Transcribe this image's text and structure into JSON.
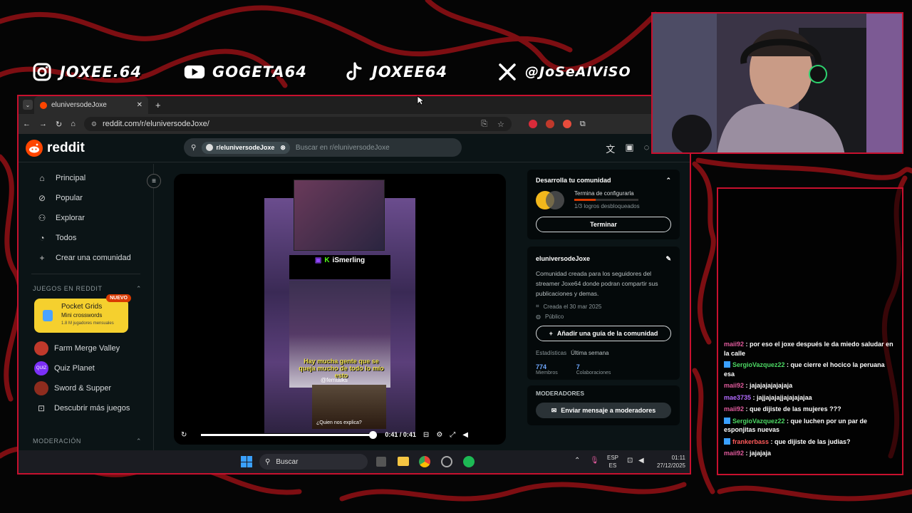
{
  "socials": [
    {
      "icon": "instagram-icon",
      "handle": "JOXEE.64"
    },
    {
      "icon": "youtube-icon",
      "handle": "GOGETA64"
    },
    {
      "icon": "tiktok-icon",
      "handle": "JOXEE64"
    },
    {
      "icon": "x-icon",
      "handle": "@JoSeAlViSO"
    }
  ],
  "browser": {
    "tab_title": "eluniversodeJoxe",
    "url": "reddit.com/r/eluniversodeJoxe/"
  },
  "reddit": {
    "logo": "reddit",
    "search_chip": "r/eluniversodeJoxe",
    "search_placeholder": "Buscar en r/eluniversodeJoxe",
    "nav": [
      "Principal",
      "Popular",
      "Explorar",
      "Todos",
      "Crear una comunidad"
    ],
    "games_section": "JUEGOS EN REDDIT",
    "featured_game": {
      "title": "Pocket Grids",
      "subtitle": "Mini crosswords",
      "players": "1.8 M jugadores mensuales",
      "badge": "NUEVO"
    },
    "games": [
      "Farm Merge Valley",
      "Quiz Planet",
      "Sword & Supper",
      "Descubrir más juegos"
    ],
    "moderation_section": "MODERACIÓN",
    "video": {
      "overlay_name": "iSmerling",
      "caption": "Hay mucha gente que se queja mucho de todo lo mío esto",
      "handle": "@femtalks",
      "meme_caption": "¿Quien nos explica?",
      "time": "0:41 / 0:41",
      "progress": 1.0
    },
    "right": {
      "develop_title": "Desarrolla tu comunidad",
      "develop_task": "Termina de configurarla",
      "develop_progress": "1/3 logros desbloqueados",
      "finish_button": "Terminar",
      "community_name": "eluniversodeJoxe",
      "description": "Comunidad creada para los seguidores del streamer Joxe64 donde podran compartir sus publicaciones y demas.",
      "created": "Creada el 30 mar 2025",
      "visibility": "Público",
      "guide_button": "Añadir una guía de la comunidad",
      "stats_label": "Estadísticas",
      "stats_period": "Última semana",
      "members_value": "774",
      "members_label": "Miembros",
      "contrib_value": "7",
      "contrib_label": "Colaboraciones",
      "moderators_title": "MODERADORES",
      "message_mods_button": "Enviar mensaje a moderadores"
    }
  },
  "taskbar": {
    "search": "Buscar",
    "lang_top": "ESP",
    "lang_bottom": "ES",
    "time": "01:11",
    "date": "27/12/2025"
  },
  "chat": [
    {
      "user": "maii92",
      "color": "#e05a9c",
      "text": ": por eso el joxe después le da miedo saludar en la calle",
      "badge": false
    },
    {
      "user": "SergioVazquez22",
      "color": "#4cd964",
      "text": ": que cierre el hocico la peruana esa",
      "badge": true
    },
    {
      "user": "maii92",
      "color": "#e05a9c",
      "text": ": jajajajajajajaja",
      "badge": false
    },
    {
      "user": "mae3735",
      "color": "#b36bff",
      "text": ": jajjajajajjajajajajaa",
      "badge": false
    },
    {
      "user": "maii92",
      "color": "#e05a9c",
      "text": ": que dijiste de las mujeres ???",
      "badge": false
    },
    {
      "user": "SergioVazquez22",
      "color": "#4cd964",
      "text": ": que luchen por un par de esponjitas nuevas",
      "badge": true
    },
    {
      "user": "frankerbass",
      "color": "#ff5a5a",
      "text": ": que dijiste de las judias?",
      "badge": true
    },
    {
      "user": "maii92",
      "color": "#e05a9c",
      "text": ": jajajaja",
      "badge": false
    }
  ]
}
